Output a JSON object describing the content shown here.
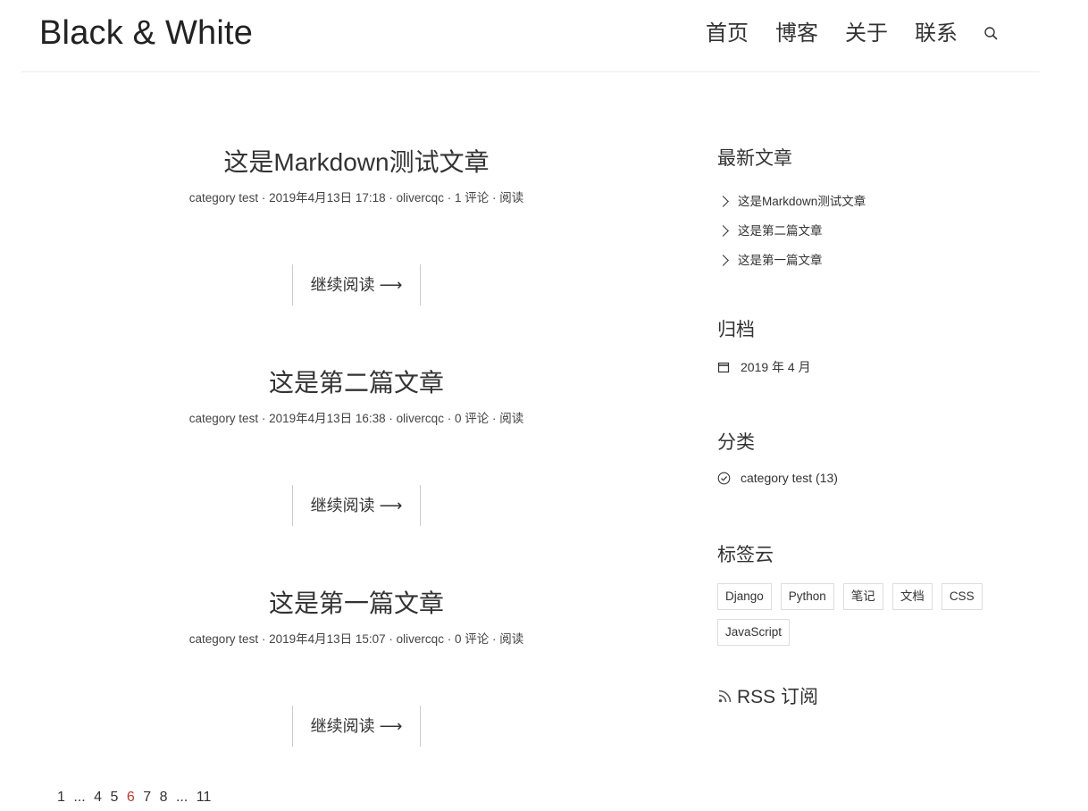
{
  "header": {
    "site_title": "Black & White",
    "nav": [
      "首页",
      "博客",
      "关于",
      "联系"
    ],
    "search_icon": "search-icon"
  },
  "posts": [
    {
      "title": "这是Markdown测试文章",
      "category": "category test",
      "date": "2019年4月13日 17:18",
      "author": "olivercqc",
      "comments": "1 评论",
      "views": "阅读",
      "read_more": "继续阅读"
    },
    {
      "title": "这是第二篇文章",
      "category": "category test",
      "date": "2019年4月13日 16:38",
      "author": "olivercqc",
      "comments": "0 评论",
      "views": "阅读",
      "read_more": "继续阅读"
    },
    {
      "title": "这是第一篇文章",
      "category": "category test",
      "date": "2019年4月13日 15:07",
      "author": "olivercqc",
      "comments": "0 评论",
      "views": "阅读",
      "read_more": "继续阅读"
    }
  ],
  "pagination": {
    "items": [
      "1",
      "...",
      "4",
      "5",
      "6",
      "7",
      "8",
      "...",
      "11"
    ],
    "current": "6",
    "current_color": "#c0392b"
  },
  "sidebar": {
    "recent": {
      "title": "最新文章",
      "items": [
        "这是Markdown测试文章",
        "这是第二篇文章",
        "这是第一篇文章"
      ]
    },
    "archive": {
      "title": "归档",
      "items": [
        "2019 年 4 月"
      ]
    },
    "categories": {
      "title": "分类",
      "items": [
        "category test (13)"
      ]
    },
    "tags": {
      "title": "标签云",
      "items": [
        "Django",
        "Python",
        "笔记",
        "文档",
        "CSS",
        "JavaScript"
      ]
    },
    "rss": {
      "label": "RSS 订阅"
    }
  }
}
